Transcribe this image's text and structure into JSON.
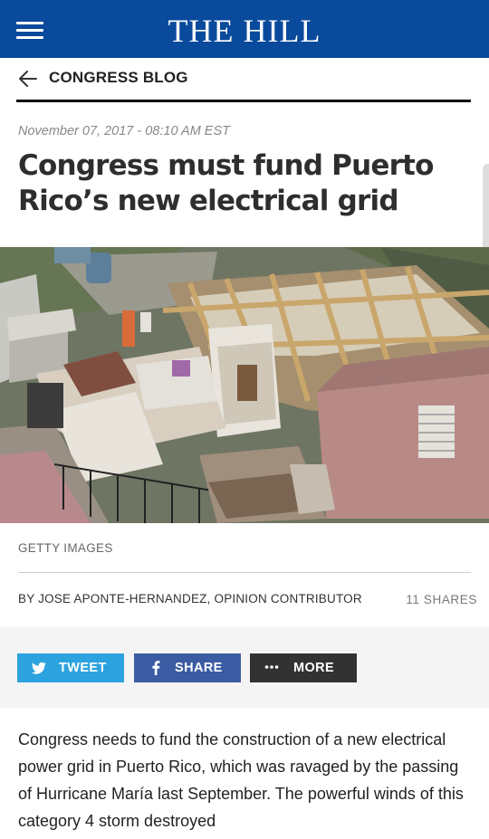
{
  "header": {
    "logo": "THE HILL"
  },
  "section": {
    "label": "CONGRESS BLOG"
  },
  "article": {
    "date": "November 07, 2017 - 08:10 AM EST",
    "headline": "Congress must fund Puerto Rico’s new electrical grid",
    "image_credit": "GETTY IMAGES",
    "byline": "BY JOSE APONTE-HERNANDEZ, OPINION CONTRIBUTOR",
    "shares": "11 SHARES",
    "body": "Congress needs to fund the construction of a new electrical power grid in Puerto Rico, which was ravaged by the passing of Hurricane María last September. The powerful winds of this category 4 storm destroyed"
  },
  "share_buttons": {
    "tweet": "TWEET",
    "share": "SHARE",
    "more": "MORE"
  },
  "icons": {
    "menu": "hamburger-icon",
    "back": "back-arrow-icon",
    "twitter": "twitter-icon",
    "facebook": "facebook-icon",
    "more": "ellipsis-icon"
  },
  "colors": {
    "header_bg": "#0a4a9c",
    "tweet": "#2ca3df",
    "facebook": "#3b5ba2",
    "more": "#323232"
  }
}
